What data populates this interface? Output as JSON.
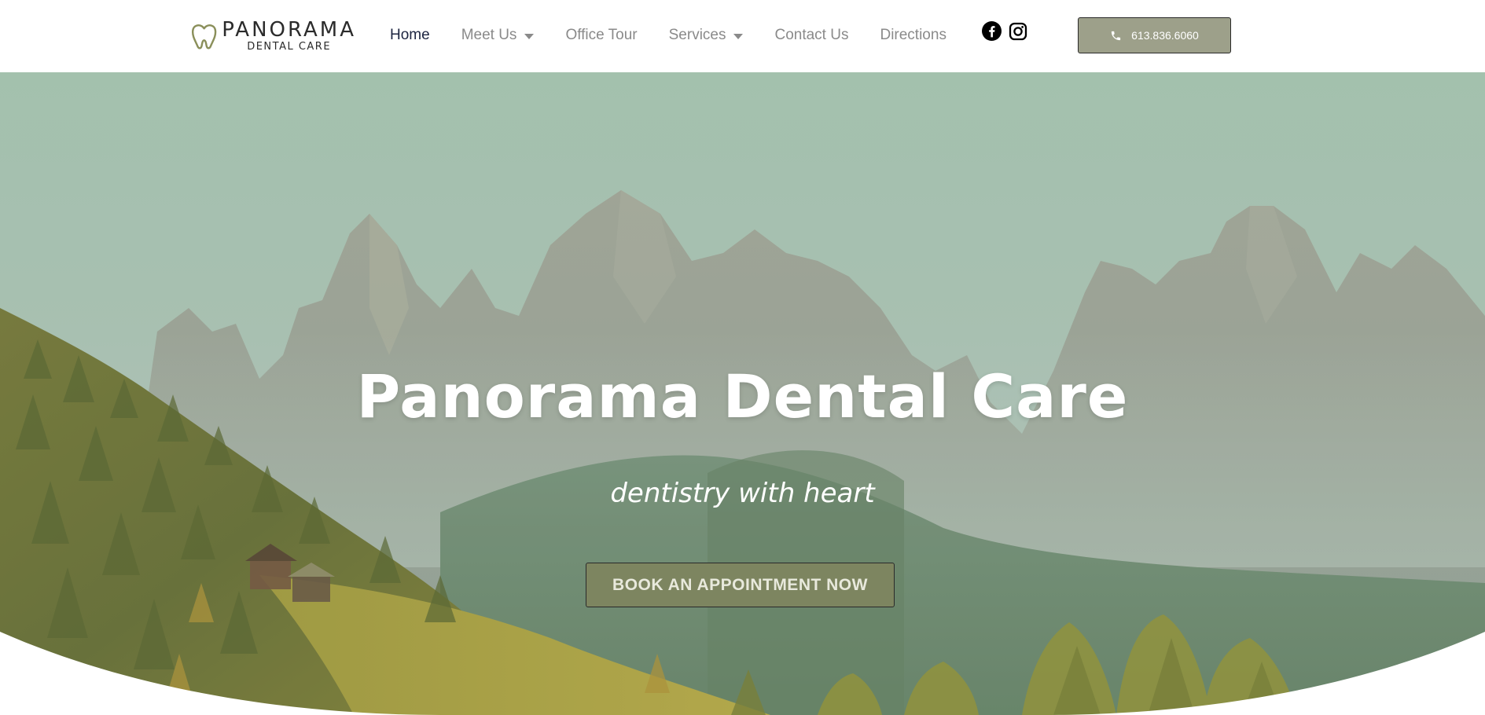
{
  "brand": {
    "name": "PANORAMA",
    "subtitle": "DENTAL CARE",
    "icon": "tooth-heart-icon",
    "accent_color": "#8a8f5a"
  },
  "nav": {
    "items": [
      {
        "label": "Home",
        "active": true,
        "dropdown": false
      },
      {
        "label": "Meet Us",
        "active": false,
        "dropdown": true
      },
      {
        "label": "Office Tour",
        "active": false,
        "dropdown": false
      },
      {
        "label": "Services",
        "active": false,
        "dropdown": true
      },
      {
        "label": "Contact Us",
        "active": false,
        "dropdown": false
      },
      {
        "label": "Directions",
        "active": false,
        "dropdown": false
      }
    ]
  },
  "social": {
    "icons": [
      "facebook-icon",
      "instagram-icon"
    ]
  },
  "phone_button": {
    "label": "613.836.6060",
    "icon": "phone-icon",
    "color": "#9da08a"
  },
  "hero": {
    "title": "Panorama Dental Care",
    "tagline": "dentistry with heart",
    "cta_label": "BOOK AN APPOINTMENT NOW",
    "cta_color": "#7d8560"
  }
}
